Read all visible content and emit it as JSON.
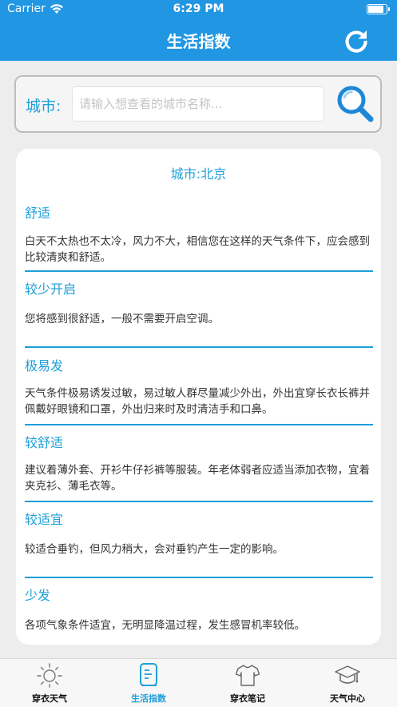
{
  "status_bar": {
    "carrier": "Carrier",
    "time": "6:29 PM"
  },
  "header": {
    "title": "生活指数"
  },
  "search": {
    "label": "城市:",
    "placeholder": "请输入想查看的城市名称...",
    "value": ""
  },
  "content": {
    "city": "城市:北京",
    "items": [
      {
        "title": "舒适",
        "desc": "白天不太热也不太冷，风力不大，相信您在这样的天气条件下，应会感到比较清爽和舒适。"
      },
      {
        "title": "较少开启",
        "desc": "您将感到很舒适，一般不需要开启空调。"
      },
      {
        "title": "极易发",
        "desc": "天气条件极易诱发过敏，易过敏人群尽量减少外出，外出宜穿长衣长裤并佩戴好眼镜和口罩，外出归来时及时清洁手和口鼻。"
      },
      {
        "title": "较舒适",
        "desc": "建议着薄外套、开衫牛仔衫裤等服装。年老体弱者应适当添加衣物，宜着夹克衫、薄毛衣等。"
      },
      {
        "title": "较适宜",
        "desc": "较适合垂钓，但风力稍大，会对垂钓产生一定的影响。"
      },
      {
        "title": "少发",
        "desc": "各项气象条件适宜，无明显降温过程，发生感冒机率较低。"
      }
    ]
  },
  "tabs": [
    {
      "label": "穿衣天气",
      "icon": "sun-icon",
      "active": false
    },
    {
      "label": "生活指数",
      "icon": "document-icon",
      "active": true
    },
    {
      "label": "穿衣笔记",
      "icon": "tshirt-icon",
      "active": false
    },
    {
      "label": "天气中心",
      "icon": "graduation-cap-icon",
      "active": false
    }
  ],
  "colors": {
    "header": "#2196e3",
    "accent": "#1e9fd8",
    "background": "#ededed"
  }
}
